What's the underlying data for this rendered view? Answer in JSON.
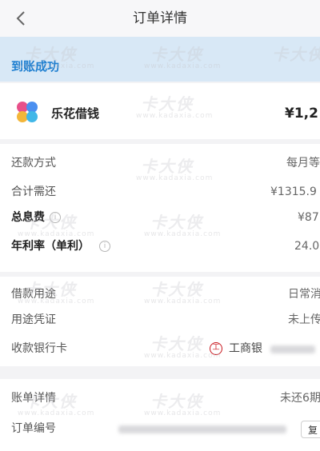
{
  "header": {
    "title": "订单详情"
  },
  "status": {
    "text": "到账成功"
  },
  "product": {
    "name": "乐花借钱",
    "amount": "¥1,2"
  },
  "loan_details": [
    {
      "label": "还款方式",
      "value": "每月等"
    },
    {
      "label": "合计需还",
      "value": "¥1315.9"
    },
    {
      "label": "总息费",
      "value": "¥87"
    },
    {
      "label": "年利率（单利）",
      "value": "24.0"
    }
  ],
  "usage": {
    "purpose_label": "借款用途",
    "purpose_value": "日常消",
    "proof_label": "用途凭证",
    "proof_value": "未上传",
    "bank_label": "收款银行卡",
    "bank_name": "工商银"
  },
  "order": {
    "bill_label": "账单详情",
    "bill_value": "未还6期",
    "order_no_label": "订单编号",
    "copy_label": "复"
  },
  "watermark": {
    "brand": "卡大侠",
    "url": "www.kadaxia.com"
  }
}
